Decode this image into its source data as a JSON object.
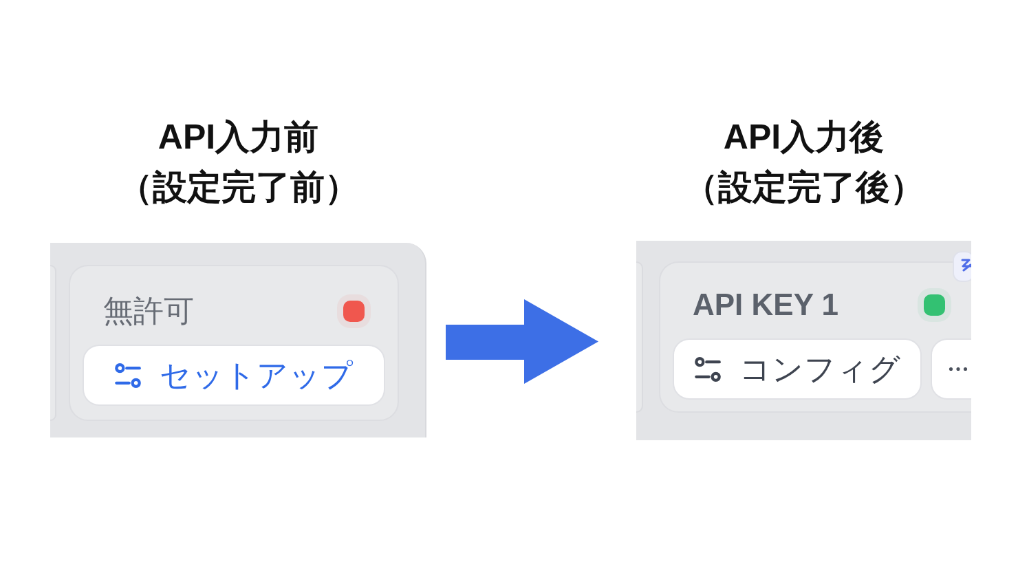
{
  "panels": [
    {
      "kind": "before",
      "heading": [
        "API入力前",
        "（設定完了前）"
      ],
      "card": {
        "configured": false,
        "label": "無許可",
        "color": "#f0574e",
        "buttons": [
          {
            "kind": "primary",
            "label": "セットアップ"
          }
        ]
      }
    },
    {
      "kind": "after",
      "heading": [
        "API入力後",
        "（設定完了後）"
      ],
      "card": {
        "configured": true,
        "label": "API KEY 1",
        "color": "#33c172",
        "corner_icon": true,
        "buttons": [
          {
            "kind": "default",
            "label": "コンフィグ"
          },
          {
            "kind": "more"
          }
        ]
      }
    }
  ]
}
